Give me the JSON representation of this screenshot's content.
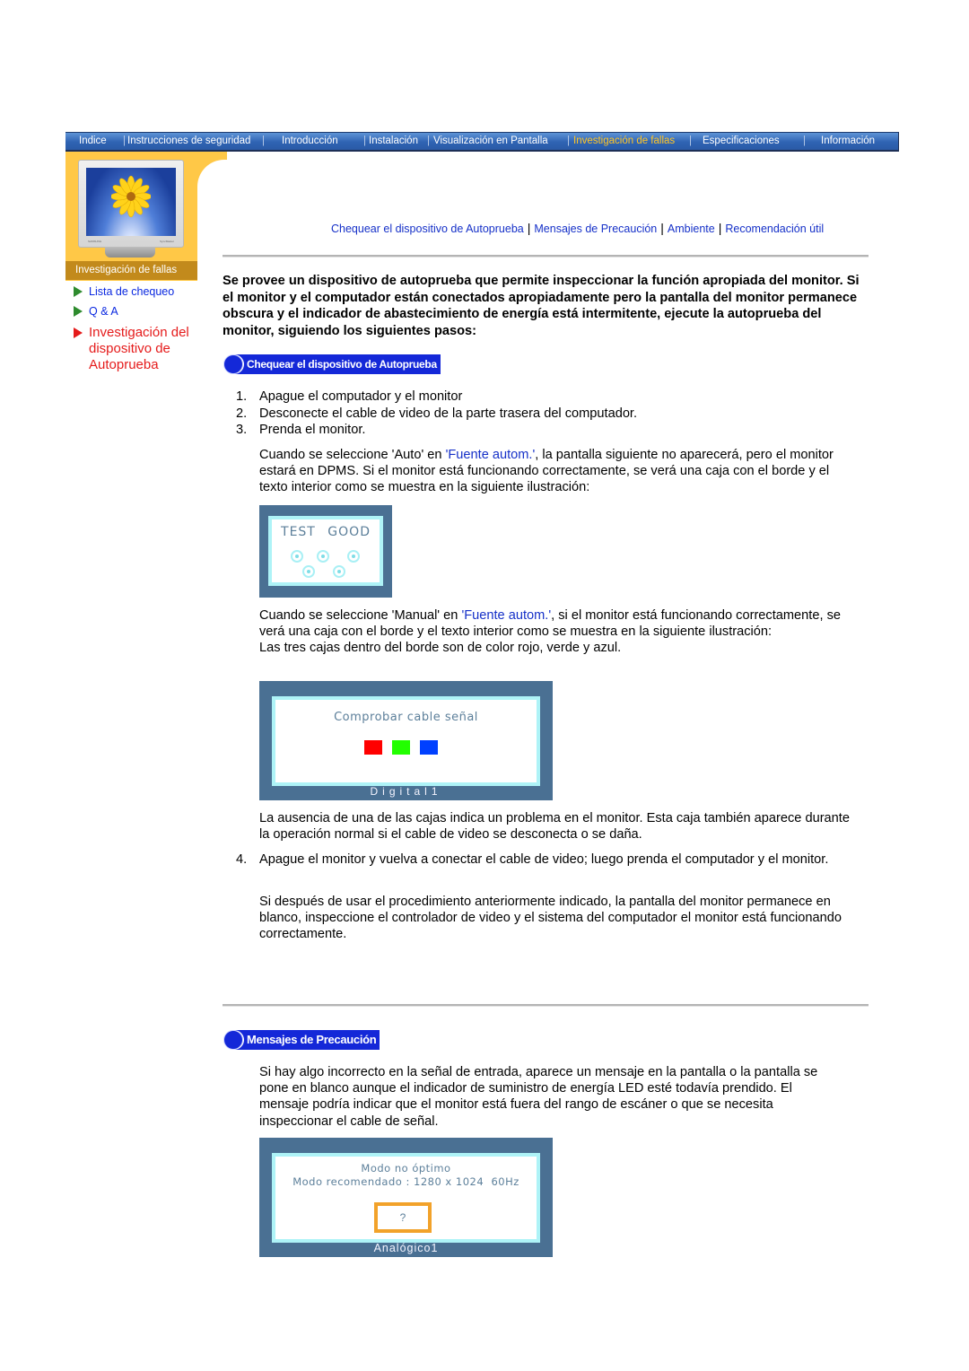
{
  "topnav": {
    "items": [
      {
        "label": "Indice",
        "active": false
      },
      {
        "label": "Instrucciones de seguridad",
        "active": false
      },
      {
        "label": "Introducción",
        "active": false
      },
      {
        "label": "Instalación",
        "active": false
      },
      {
        "label": "Visualización en Pantalla",
        "active": false
      },
      {
        "label": "Investigación de fallas",
        "active": true
      },
      {
        "label": "Especificaciones",
        "active": false
      },
      {
        "label": "Información",
        "active": false
      }
    ],
    "separator": "|",
    "active_color": "#ffc526"
  },
  "sidebar": {
    "image_alt": "monitor-with-flower",
    "monitor_brand_left": "SAMSUNG",
    "monitor_brand_right": "SyncMaster",
    "title": "Investigación de fallas",
    "links": [
      {
        "label": "Lista de chequeo",
        "icon": "green-triangle-icon",
        "active": false
      },
      {
        "label": "Q & A",
        "icon": "green-triangle-icon",
        "active": false
      },
      {
        "label": "Investigación del dispositivo de Autoprueba",
        "icon": "red-triangle-icon",
        "active": true
      }
    ]
  },
  "subnav": {
    "links": [
      "Chequear el dispositivo de Autoprueba",
      "Mensajes de Precaución",
      "Ambiente",
      "Recomendación útil"
    ],
    "separator": "|"
  },
  "intro": "Se provee un dispositivo de autoprueba que permite inspeccionar la función apropiada del monitor. Si el monitor y el computador están conectados apropiadamente pero la pantalla del monitor permanece obscura y el indicador de abastecimiento de energía está intermitente, ejecute la autoprueba del monitor, siguiendo los siguientes pasos:",
  "section1": {
    "badge": "Chequear el dispositivo de Autoprueba",
    "steps": [
      {
        "num": "1.",
        "text": "Apague el computador y el monitor"
      },
      {
        "num": "2.",
        "text": "Desconecte el cable de video de la parte trasera del computador."
      },
      {
        "num": "3.",
        "text": "Prenda el monitor."
      }
    ],
    "auto_para": {
      "before": "Cuando se seleccione 'Auto' en ",
      "link": "'Fuente autom.'",
      "after": ", la pantalla siguiente no aparecerá, pero el monitor estará en DPMS. Si el monitor está funcionando correctamente, se verá una caja con el borde y el texto interior como se muestra en la siguiente ilustración:"
    },
    "osd_test": {
      "text": "TEST GOOD"
    },
    "manual_para": {
      "before": "Cuando se seleccione 'Manual' en ",
      "link": "'Fuente autom.'",
      "after": ", si el monitor está funcionando correctamente, se verá una caja con el borde y el texto interior como se muestra en la siguiente ilustración:"
    },
    "colors_para": "Las tres cajas dentro del borde son de color rojo, verde y azul.",
    "osd_cable": {
      "title": "Comprobar cable señal",
      "caption": "Digital1",
      "boxes": [
        {
          "name": "red",
          "color": "#ff0000"
        },
        {
          "name": "green",
          "color": "#22ff00"
        },
        {
          "name": "blue",
          "color": "#0040ff"
        }
      ]
    },
    "absence_para": "La ausencia de una de las cajas indica un problema en el monitor. Esta caja también aparece durante la operación normal si el cable de video se desconecta o se daña.",
    "step4": {
      "num": "4.",
      "text": "Apague el monitor y vuelva a conectar el cable de video; luego prenda el computador y el monitor."
    },
    "after_para": "Si después de usar el procedimiento anteriormente indicado, la pantalla del monitor permanece en blanco, inspeccione el controlador de video y el sistema del computador el monitor está funcionando correctamente."
  },
  "section2": {
    "badge": "Mensajes de Precaución",
    "para": "Si hay algo incorrecto en la señal de entrada, aparece un mensaje en la pantalla o la pantalla se pone en blanco aunque el indicador de suministro de energía LED esté todavía prendido. El mensaje podría indicar que el monitor está fuera del rango de escáner o que se necesita inspeccionar el cable de señal.",
    "osd_mode": {
      "line1": "Modo no óptimo",
      "line2": "Modo recomendado : 1280 x 1024  60Hz",
      "button": "?",
      "caption": "Analógico1"
    }
  }
}
